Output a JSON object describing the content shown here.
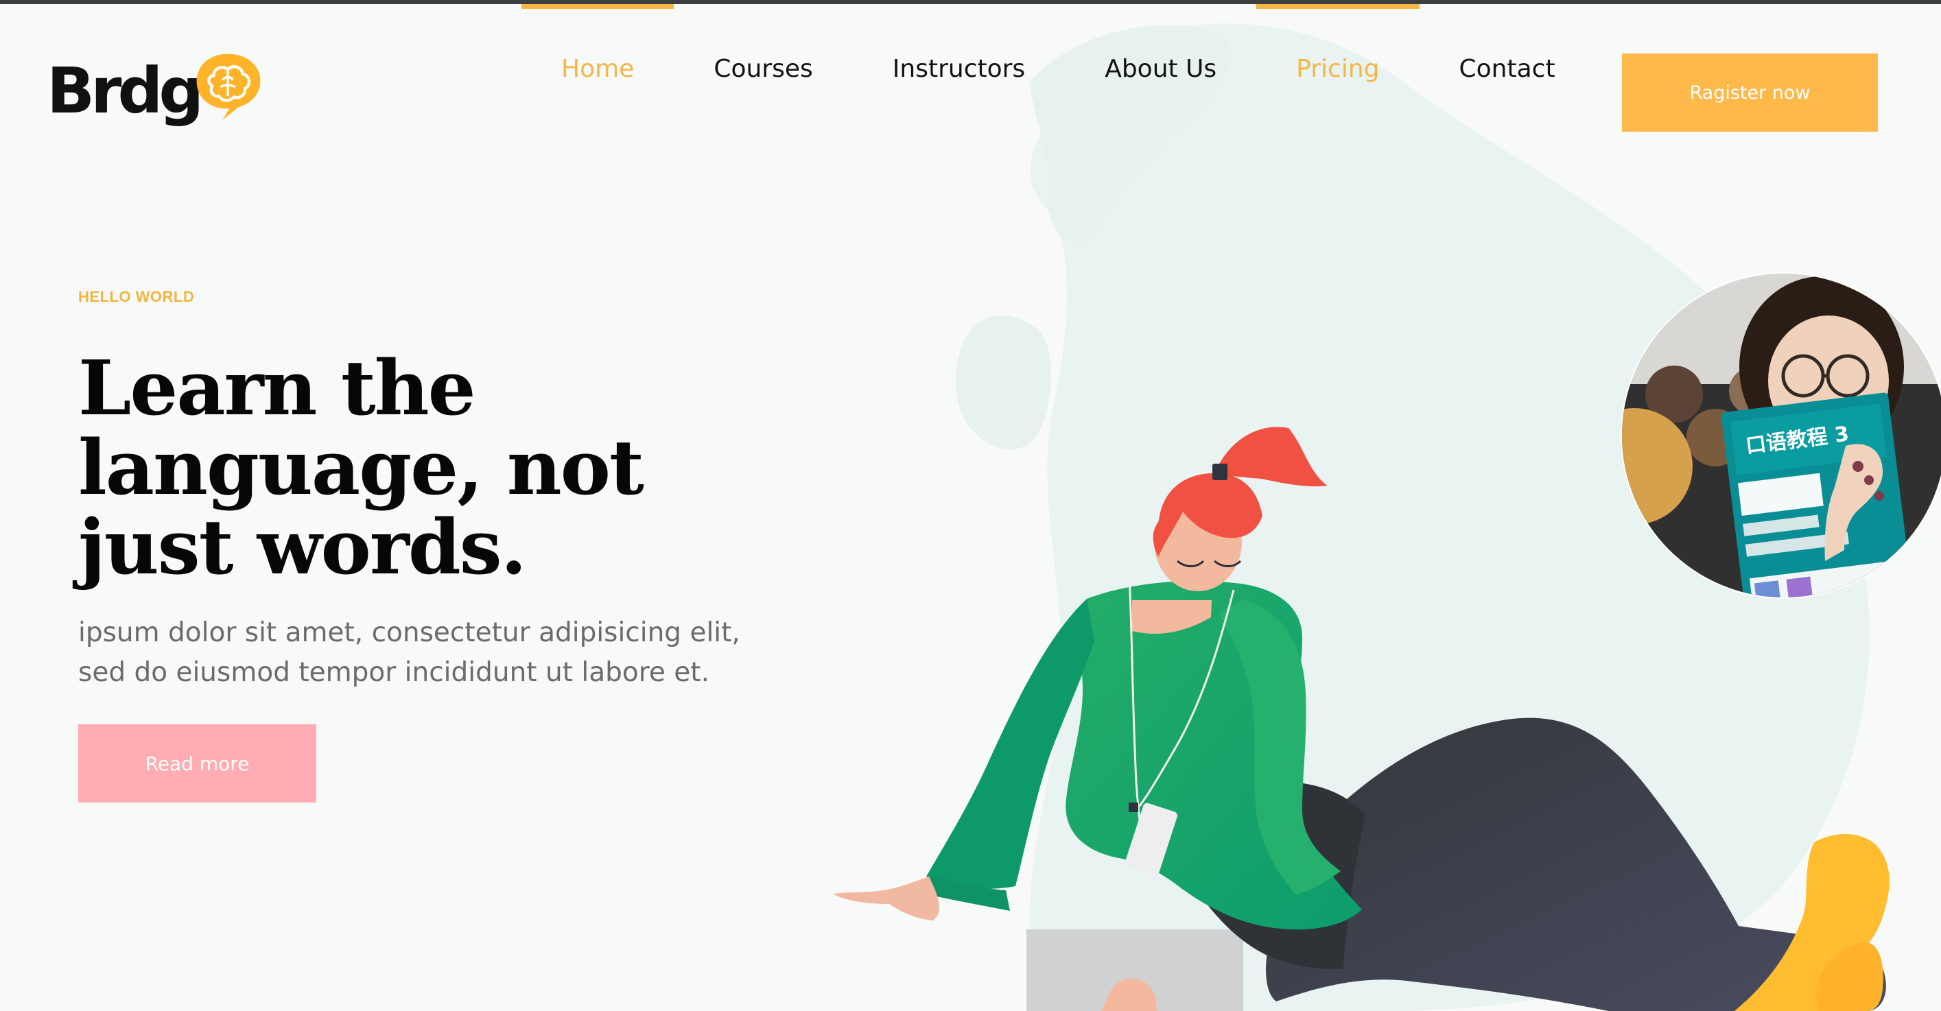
{
  "brand": {
    "name": "Brdg",
    "accent_color": "#f6b545",
    "dark_color": "#121212",
    "pink_color": "#ffadb2"
  },
  "nav": {
    "items": [
      {
        "label": "Home",
        "active": true
      },
      {
        "label": "Courses",
        "active": false
      },
      {
        "label": "Instructors",
        "active": false
      },
      {
        "label": "About Us",
        "active": false
      },
      {
        "label": "Pricing",
        "active": true
      },
      {
        "label": "Contact",
        "active": false
      }
    ],
    "register_label": "Ragister now"
  },
  "hero": {
    "eyebrow": "HELLO WORLD",
    "title": "Learn the language, not just words.",
    "description": "ipsum dolor sit amet, consectetur adipisicing elit, sed do eiusmod tempor incididunt ut labore et.",
    "button_label": "Read more"
  },
  "illustration": {
    "book_title": "口语教程 3",
    "icons": [
      "brain-icon",
      "woman-illustration",
      "reading-photo-circle"
    ]
  }
}
